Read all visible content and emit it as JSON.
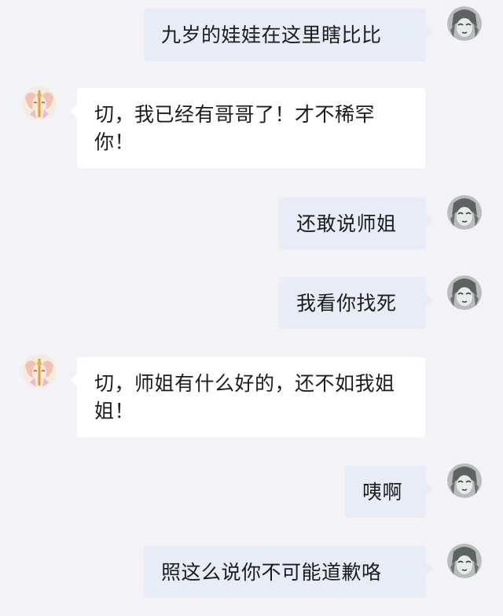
{
  "conversation": {
    "messages": [
      {
        "side": "right",
        "text": "九岁的娃娃在这里瞎比比"
      },
      {
        "side": "left",
        "text": "切，我已经有哥哥了！才不稀罕你！"
      },
      {
        "side": "right",
        "text": "还敢说师姐"
      },
      {
        "side": "right",
        "text": "我看你找死"
      },
      {
        "side": "left",
        "text": "切，师姐有什么好的，还不如我姐姐！"
      },
      {
        "side": "right",
        "text": "咦啊"
      },
      {
        "side": "right",
        "text": "照这么说你不可能道歉咯"
      }
    ]
  },
  "colors": {
    "background": "#f3f3f7",
    "bubble_right": "#e8ecf6",
    "bubble_left": "#ffffff",
    "text": "#1c1c1c"
  },
  "avatars": {
    "right": "anime-avatar-grayscale-icon",
    "left": "anime-avatar-pastel-icon"
  }
}
